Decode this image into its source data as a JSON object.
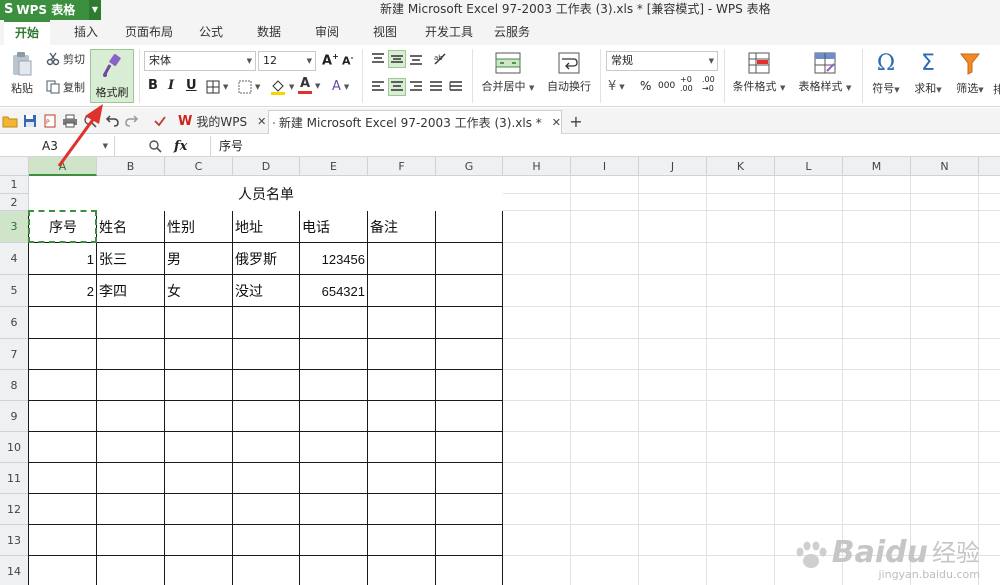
{
  "app": {
    "name": "WPS 表格",
    "logo_letter": "S",
    "document_title": "新建 Microsoft Excel 97-2003 工作表 (3).xls * [兼容模式] - WPS 表格"
  },
  "ribbon_tabs": [
    {
      "label": "开始",
      "active": true
    },
    {
      "label": "插入",
      "active": false
    },
    {
      "label": "页面布局",
      "active": false
    },
    {
      "label": "公式",
      "active": false
    },
    {
      "label": "数据",
      "active": false
    },
    {
      "label": "审阅",
      "active": false
    },
    {
      "label": "视图",
      "active": false
    },
    {
      "label": "开发工具",
      "active": false
    },
    {
      "label": "云服务",
      "active": false
    }
  ],
  "ribbon": {
    "paste_label": "粘贴",
    "cut_label": "剪切",
    "copy_label": "复制",
    "format_brush_label": "格式刷",
    "font_name": "宋体",
    "font_size": "12",
    "bold": "B",
    "italic": "I",
    "underline": "U",
    "merge_center_label": "合并居中",
    "wrap_text_label": "自动换行",
    "number_format": "常规",
    "percent": "%",
    "comma": "000",
    "cond_format_label": "条件格式",
    "table_style_label": "表格样式",
    "symbol_label": "符号",
    "sum_label": "求和",
    "filter_label": "筛选",
    "more_label": "排"
  },
  "doc_tabs": [
    {
      "label": "我的WPS",
      "active": false
    },
    {
      "label": "新建 Microsoft Excel 97-2003 工作表 (3).xls *",
      "active": true
    }
  ],
  "formula_bar": {
    "name_box": "A3",
    "fx": "fx",
    "content": "序号"
  },
  "columns": [
    "A",
    "B",
    "C",
    "D",
    "E",
    "F",
    "G",
    "H",
    "I",
    "J",
    "K",
    "L",
    "M",
    "N"
  ],
  "rows": [
    "1",
    "2",
    "3",
    "4",
    "5",
    "6",
    "7",
    "8",
    "9",
    "10",
    "11",
    "12",
    "13",
    "14"
  ],
  "sheet": {
    "title": "人员名单",
    "headers": [
      "序号",
      "姓名",
      "性别",
      "地址",
      "电话",
      "备注"
    ],
    "records": [
      [
        "1",
        "张三",
        "男",
        "俄罗斯",
        "123456",
        ""
      ],
      [
        "2",
        "李四",
        "女",
        "没过",
        "654321",
        ""
      ]
    ]
  },
  "watermark": {
    "brand": "Baidu",
    "brand_cn": "经验",
    "url": "jingyan.baidu.com"
  },
  "colors": {
    "accent": "#3c8f3e",
    "title_bar": "#f4f4f4",
    "selection": "#cfe4c8",
    "annotation_arrow": "#e0312c"
  }
}
